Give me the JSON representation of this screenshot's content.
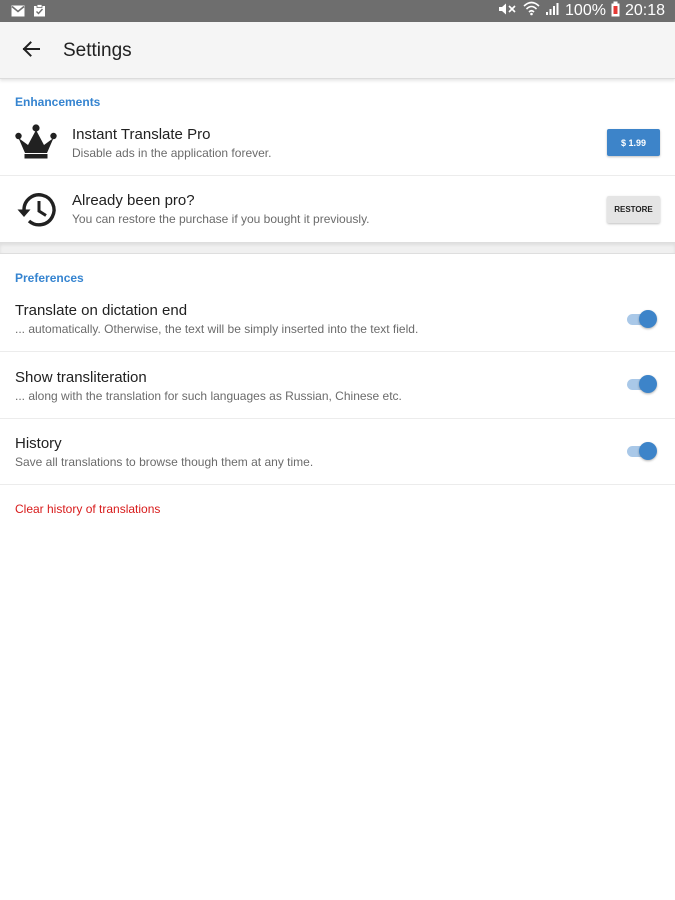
{
  "status_bar": {
    "battery_percent": "100%",
    "time": "20:18",
    "icons": [
      "gmail-icon",
      "clipboard-icon",
      "mute-icon",
      "wifi-icon",
      "signal-icon",
      "battery-icon"
    ]
  },
  "app_bar": {
    "title": "Settings",
    "back_icon": "arrow-back-icon"
  },
  "enhancements": {
    "header": "Enhancements",
    "items": [
      {
        "icon": "crown-icon",
        "title": "Instant Translate Pro",
        "subtitle": "Disable ads in the application forever.",
        "button_label": "$ 1.99"
      },
      {
        "icon": "history-restore-icon",
        "title": "Already been pro?",
        "subtitle": "You can restore the purchase if you bought it previously.",
        "button_label": "RESTORE"
      }
    ]
  },
  "preferences": {
    "header": "Preferences",
    "items": [
      {
        "title": "Translate on dictation end",
        "subtitle": "... automatically. Otherwise, the text will be simply inserted into the text field.",
        "enabled": true
      },
      {
        "title": "Show transliteration",
        "subtitle": "... along with the translation for such languages as Russian, Chinese etc.",
        "enabled": true
      },
      {
        "title": "History",
        "subtitle": "Save all translations to browse though them at any time.",
        "enabled": true
      }
    ],
    "clear_history_label": "Clear history of translations"
  },
  "colors": {
    "accent": "#3d84c9",
    "header_text": "#3584d0",
    "danger": "#d81b1b",
    "status_bar": "#6e6e6e"
  }
}
